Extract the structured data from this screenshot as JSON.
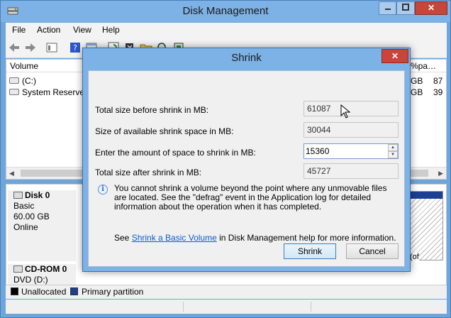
{
  "window": {
    "title": "Disk Management",
    "min_icon": "minimize-icon",
    "max_icon": "maximize-icon",
    "close_label": "✕"
  },
  "menu": [
    "File",
    "Action",
    "View",
    "Help"
  ],
  "volume_list": {
    "header": {
      "volume": "Volume",
      "right_col": "% Fre…",
      "right_col_short": "%pa…"
    },
    "rows": [
      {
        "label": "(C:)",
        "cap": "GB",
        "free": "87"
      },
      {
        "label": "System Reserved",
        "cap": "GB",
        "free": "39"
      }
    ]
  },
  "disks": [
    {
      "name": "Disk 0",
      "type": "Basic",
      "size": "60.00 GB",
      "status": "Online"
    },
    {
      "name": "CD-ROM 0",
      "type": "DVD (D:)"
    }
  ],
  "right_strip": {
    "txt1": "",
    "txt2": "(of"
  },
  "legend": {
    "items": [
      {
        "label": "Unallocated",
        "color": "#000000"
      },
      {
        "label": "Primary partition",
        "color": "#1c3f93"
      }
    ]
  },
  "dialog": {
    "title": "Shrink",
    "close_label": "✕",
    "fields": [
      {
        "label": "Total size before shrink in MB:",
        "value": "61087"
      },
      {
        "label": "Size of available shrink space in MB:",
        "value": "30044"
      },
      {
        "label": "Enter the amount of space to shrink in MB:",
        "value": "15360"
      },
      {
        "label": "Total size after shrink in MB:",
        "value": "45727"
      }
    ],
    "info": "You cannot shrink a volume beyond the point where any unmovable files are located. See the \"defrag\" event in the Application log for detailed information about the operation when it has completed.",
    "see_prefix": "See ",
    "see_link": "Shrink a Basic Volume",
    "see_suffix": " in Disk Management help for more information.",
    "shrink_label": "Shrink",
    "cancel_label": "Cancel"
  }
}
